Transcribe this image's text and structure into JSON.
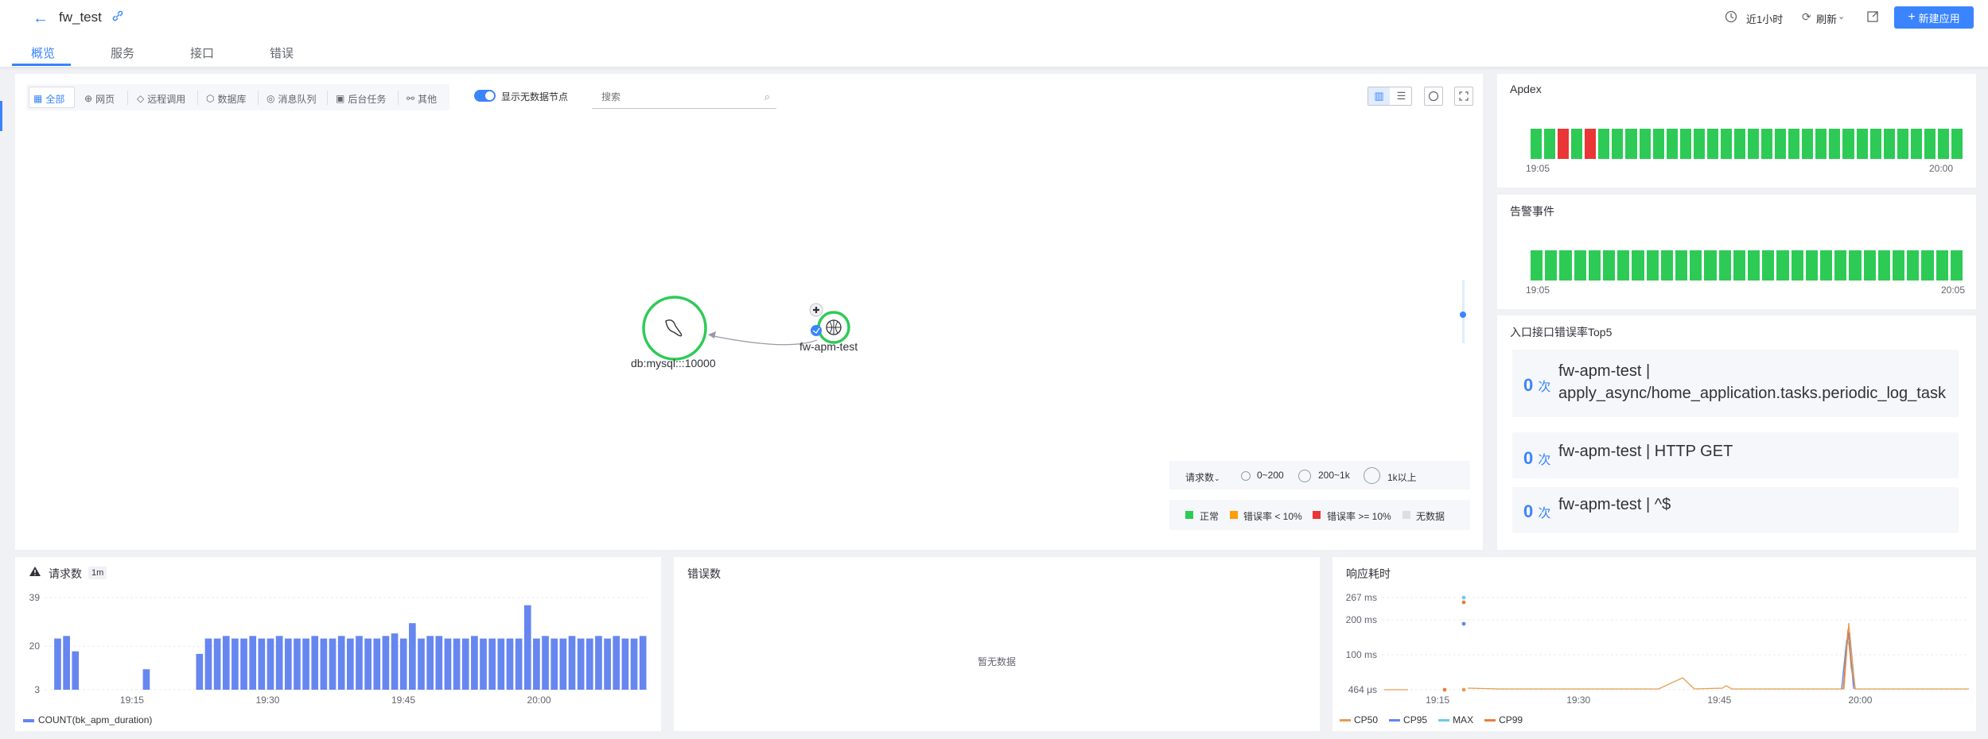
{
  "header": {
    "app_name": "fw_test",
    "time_range": "近1小时",
    "refresh": "刷新",
    "new_app": "新建应用"
  },
  "tabs": [
    "概览",
    "服务",
    "接口",
    "错误"
  ],
  "filters": [
    "全部",
    "网页",
    "远程调用",
    "数据库",
    "消息队列",
    "后台任务",
    "其他"
  ],
  "toggle_label": "显示无数据节点",
  "search": {
    "placeholder": "搜索"
  },
  "topology": {
    "node_db": "db:mysql:::10000",
    "node_app": "fw-apm-test"
  },
  "legend_size": {
    "metric": "请求数",
    "ranges": [
      "0~200",
      "200~1k",
      "1k以上"
    ]
  },
  "legend_status": [
    {
      "label": "正常",
      "color": "#2dcb56"
    },
    {
      "label": "错误率 < 10%",
      "color": "#ff9c01"
    },
    {
      "label": "错误率 >= 10%",
      "color": "#ea3636"
    },
    {
      "label": "无数据",
      "color": "#dcdee5"
    }
  ],
  "apdex": {
    "title": "Apdex",
    "start": "19:05",
    "end": "20:00",
    "bars": [
      "ok",
      "ok",
      "err",
      "ok",
      "err",
      "ok",
      "ok",
      "ok",
      "ok",
      "ok",
      "ok",
      "ok",
      "ok",
      "ok",
      "ok",
      "ok",
      "ok",
      "ok",
      "ok",
      "ok",
      "ok",
      "ok",
      "ok",
      "ok",
      "ok",
      "ok",
      "ok",
      "ok",
      "ok",
      "ok",
      "ok",
      "ok"
    ]
  },
  "alerts": {
    "title": "告警事件",
    "start": "19:05",
    "end": "20:05",
    "count": 30
  },
  "top5": {
    "title": "入口接口错误率Top5",
    "unit": "次",
    "items": [
      {
        "count": "0",
        "line1": "fw-apm-test |",
        "line2": "apply_async/home_application.tasks.periodic_log_task"
      },
      {
        "count": "0",
        "line1": "fw-apm-test | HTTP GET",
        "line2": ""
      },
      {
        "count": "0",
        "line1": "fw-apm-test | ^$",
        "line2": ""
      }
    ]
  },
  "req_panel": {
    "title": "请求数",
    "interval": "1m",
    "legend": "COUNT(bk_apm_duration)"
  },
  "err_panel": {
    "title": "错误数",
    "empty": "暂无数据"
  },
  "resp_panel": {
    "title": "响应耗时",
    "legend": [
      "CP50",
      "CP95",
      "MAX",
      "CP99"
    ]
  },
  "chart_data": [
    {
      "type": "bar",
      "title": "请求数",
      "series": [
        {
          "name": "COUNT(bk_apm_duration)",
          "values": [
            0,
            23,
            24,
            18,
            0,
            0,
            0,
            0,
            0,
            0,
            0,
            11,
            0,
            0,
            0,
            0,
            0,
            17,
            23,
            23,
            24,
            23,
            23,
            24,
            23,
            23,
            24,
            23,
            23,
            23,
            24,
            23,
            23,
            24,
            23,
            24,
            23,
            23,
            24,
            25,
            23,
            29,
            23,
            24,
            24,
            23,
            23,
            23,
            24,
            23,
            23,
            23,
            23,
            23,
            36,
            23,
            24,
            23,
            23,
            24,
            23,
            23,
            24,
            23,
            24,
            23,
            23,
            24
          ]
        }
      ],
      "x_ticks": [
        "19:15",
        "19:30",
        "19:45",
        "20:00"
      ],
      "y_ticks": [
        3,
        20,
        39
      ],
      "ylim": [
        3,
        39
      ]
    },
    {
      "type": "line",
      "title": "响应耗时",
      "y_ticks": [
        "464 μs",
        "100 ms",
        "200 ms",
        "267 ms"
      ],
      "x_ticks": [
        "19:15",
        "19:30",
        "19:45",
        "20:00"
      ],
      "series": [
        {
          "name": "CP50",
          "color": "#e89c51"
        },
        {
          "name": "CP95",
          "color": "#6686f0"
        },
        {
          "name": "MAX",
          "color": "#6dcbe8"
        },
        {
          "name": "CP99",
          "color": "#e87f3c"
        }
      ]
    }
  ]
}
